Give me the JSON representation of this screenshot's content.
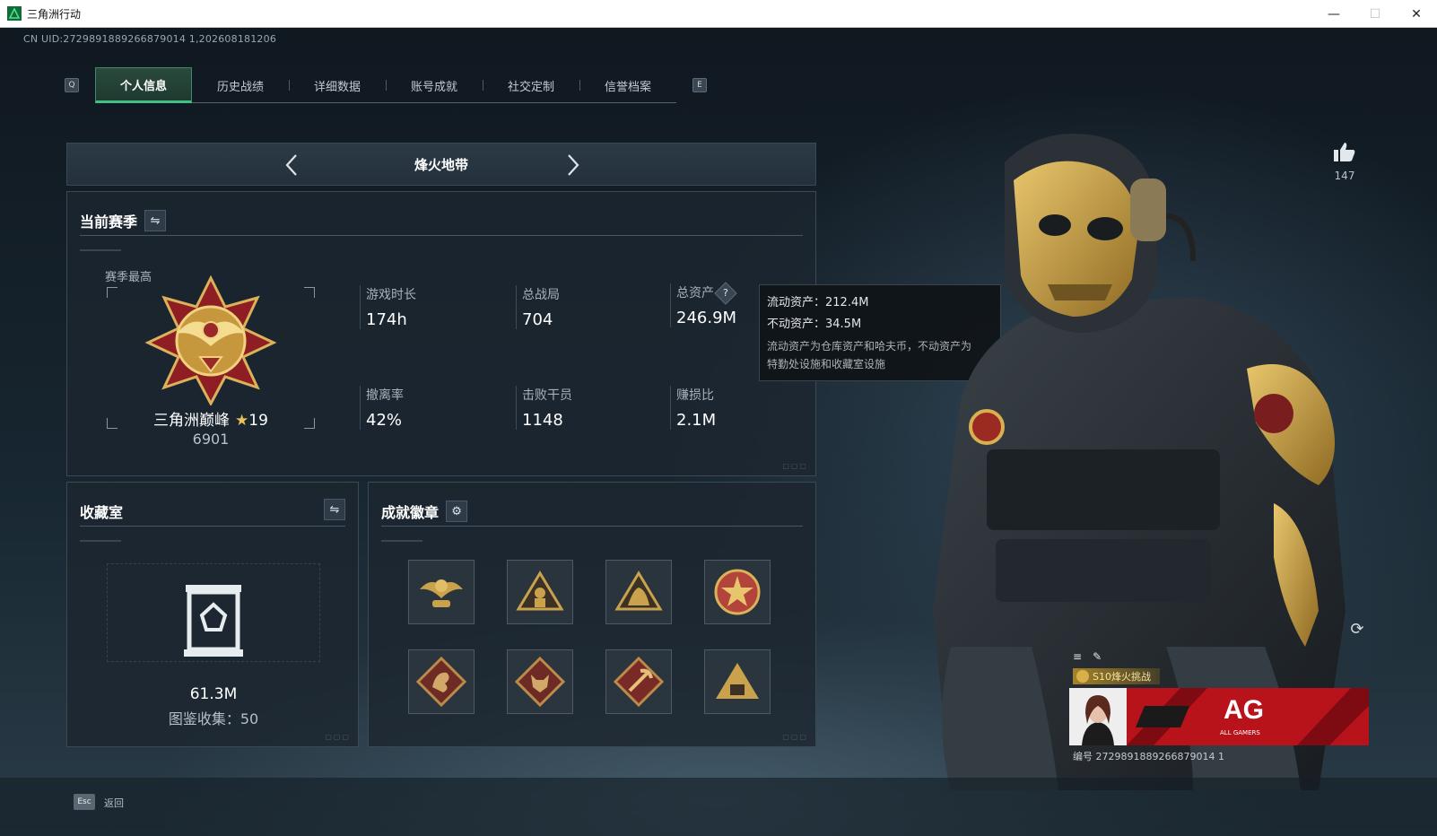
{
  "window": {
    "title": "三角洲行动",
    "minimize": "—",
    "maximize": "☐",
    "close": "✕"
  },
  "uid": "CN UID:2729891889266879014 1,202608181206",
  "tabs": {
    "left_key": "Q",
    "right_key": "E",
    "items": [
      {
        "label": "个人信息",
        "active": true
      },
      {
        "label": "历史战绩",
        "active": false
      },
      {
        "label": "详细数据",
        "active": false
      },
      {
        "label": "账号成就",
        "active": false
      },
      {
        "label": "社交定制",
        "active": false
      },
      {
        "label": "信誉档案",
        "active": false
      }
    ]
  },
  "mode": {
    "title": "烽火地带",
    "prev_icon": "chevron-left-icon",
    "next_icon": "chevron-right-icon"
  },
  "season": {
    "title": "当前赛季",
    "best_label": "赛季最高",
    "rank_name": "三角洲巅峰",
    "rank_stars": "19",
    "rank_score": "6901",
    "stats": {
      "playtime": {
        "label": "游戏时长",
        "value": "174h"
      },
      "matches": {
        "label": "总战局",
        "value": "704"
      },
      "assets": {
        "label": "总资产",
        "value": "246.9M"
      },
      "extract_rate": {
        "label": "撤离率",
        "value": "42%"
      },
      "kills": {
        "label": "击败干员",
        "value": "1148"
      },
      "profit_ratio": {
        "label": "赚损比",
        "value": "2.1M"
      }
    },
    "help_glyph": "?"
  },
  "tooltip": {
    "liquid": "流动资产：212.4M",
    "fixed": "不动资产：34.5M",
    "desc1": "流动资产为仓库资产和哈夫币，不动资产为",
    "desc2": "特勤处设施和收藏室设施"
  },
  "collection": {
    "title": "收藏室",
    "value": "61.3M",
    "count": "图鉴收集：50"
  },
  "achievements": {
    "title": "成就徽章",
    "badges": [
      {
        "name": "winged-emblem-badge-icon",
        "color": "#c9a24a"
      },
      {
        "name": "triangle-soldier-badge-icon",
        "color": "#caa14d"
      },
      {
        "name": "triangle-beast-badge-icon",
        "color": "#caa14d"
      },
      {
        "name": "star-shield-badge-icon",
        "color": "#b3443c"
      },
      {
        "name": "dragon-badge-icon",
        "color": "#a5463c"
      },
      {
        "name": "wolf-badge-icon",
        "color": "#a5463c"
      },
      {
        "name": "pickaxe-badge-icon",
        "color": "#a5463c"
      },
      {
        "name": "pyramid-badge-icon",
        "color": "#caa14d"
      }
    ]
  },
  "bottom": {
    "esc_key": "Esc",
    "back_label": "返回"
  },
  "likes": {
    "count": "147"
  },
  "card": {
    "tag": "S10烽火挑战",
    "id": "编号 2729891889266879014 1",
    "banner_text": "AG",
    "banner_sub": "ALL GAMERS"
  },
  "colors": {
    "accent_green": "#42c083",
    "gold": "#e8c35a",
    "banner_red": "#c9141d"
  }
}
